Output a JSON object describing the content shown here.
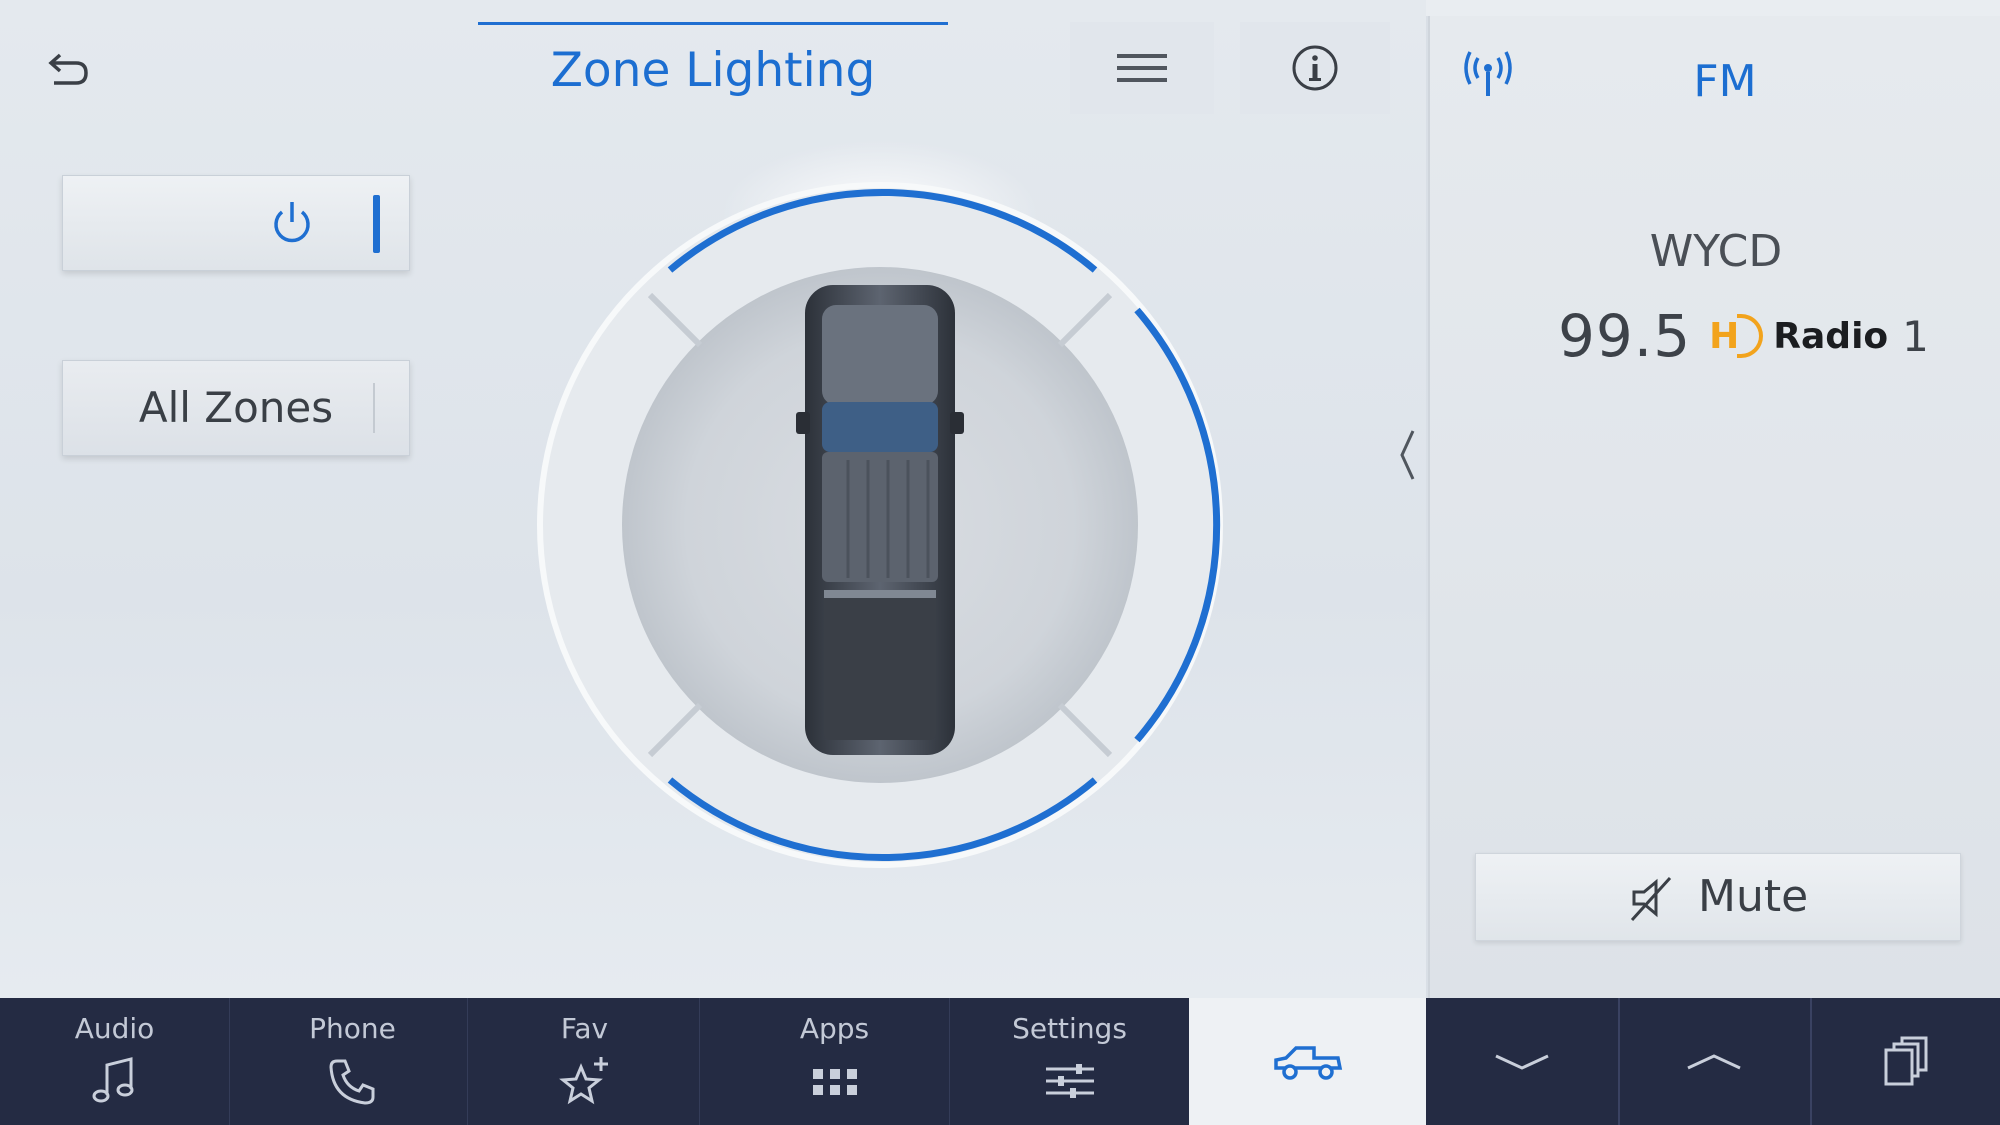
{
  "header": {
    "title": "Zone Lighting",
    "back_icon": "back-arrow-icon",
    "menu_icon": "hamburger-menu-icon",
    "info_icon": "info-icon"
  },
  "controls": {
    "power_icon": "power-icon",
    "power_state": "on",
    "zones_label": "All Zones"
  },
  "zone_dial": {
    "vehicle_icon": "pickup-truck-top-view",
    "zones": [
      "front",
      "right",
      "rear",
      "left"
    ],
    "active_zones": [
      "front",
      "right",
      "rear"
    ],
    "accent_color": "#1f6fd1"
  },
  "radio": {
    "band": "FM",
    "station": "WYCD",
    "frequency": "99.5",
    "hd_label": "Radio",
    "hd_channel": "1",
    "mute_label": "Mute",
    "signal_icon": "antenna-icon"
  },
  "dock": {
    "items": [
      {
        "label": "Audio",
        "icon": "music-note-icon"
      },
      {
        "label": "Phone",
        "icon": "phone-icon"
      },
      {
        "label": "Fav",
        "icon": "star-plus-icon"
      },
      {
        "label": "Apps",
        "icon": "apps-grid-icon"
      },
      {
        "label": "Settings",
        "icon": "sliders-icon"
      }
    ],
    "vehicle_icon": "truck-side-icon",
    "controls": [
      "chevron-down-icon",
      "chevron-up-icon",
      "copy-icon"
    ]
  },
  "colors": {
    "accent": "#1c6ed1",
    "dock_bg": "#242b43",
    "hd_orange": "#f2a31c"
  }
}
